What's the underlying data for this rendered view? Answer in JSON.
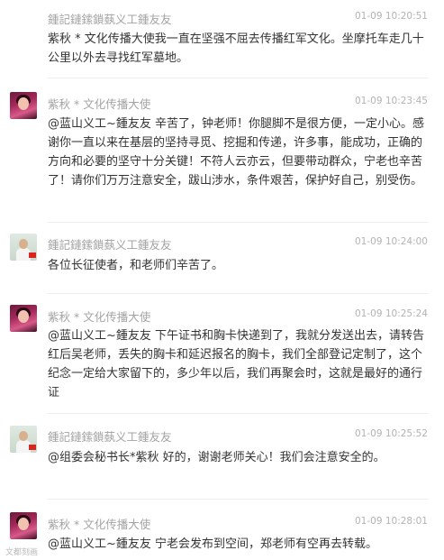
{
  "comments": [
    {
      "author": "鍾記鏈鎍鎖蓺义工鍾友友",
      "time": "01-09 10:20:51",
      "text": "紫秋 * 文化传播大使我一直在坚强不屈去传播红军文化。坐摩托车走几十公里以外去寻找红军墓地。"
    },
    {
      "author": "紫秋 * 文化传播大使",
      "time": "01-09 10:23:45",
      "text": "@蓝山义工~鍾友友 辛苦了，钟老师！你腿脚不是很方便，一定小心。感谢你一直以来在基层的坚持寻觅、挖掘和传递，许多事，能成功，正确的方向和必要的坚守十分关键！不符人云亦云，但要带动群众，宁老也辛苦了！请你们万万注意安全，跋山涉水，条件艰苦，保护好自己，别受伤。"
    },
    {
      "author": "鍾記鏈鎍鎖蓺义工鍾友友",
      "time": "01-09 10:24:00",
      "text": "各位长征使者，和老师们辛苦了。"
    },
    {
      "author": "紫秋 * 文化传播大使",
      "time": "01-09 10:25:24",
      "text": "@蓝山义工~鍾友友 下午证书和胸卡快递到了，我就分发送出去，请转告红后吴老师，丢失的胸卡和延迟报名的胸卡，我们全部登记定制了，这个纪念一定给大家留下的，多少年以后，我们再聚会时，这就是最好的通行证"
    },
    {
      "author": "鍾記鏈鎍鎖蓺义工鍾友友",
      "time": "01-09 10:25:52",
      "text": "@组委会秘书长*紫秋 好的，谢谢老师关心！我们会注意安全的。"
    },
    {
      "author": "紫秋 * 文化传播大使",
      "time": "01-09 10:28:01",
      "text": "@蓝山义工~鍾友友 宁老会发布到空间，郑老师有空再去转载。"
    }
  ],
  "watermark": "文都刻画"
}
